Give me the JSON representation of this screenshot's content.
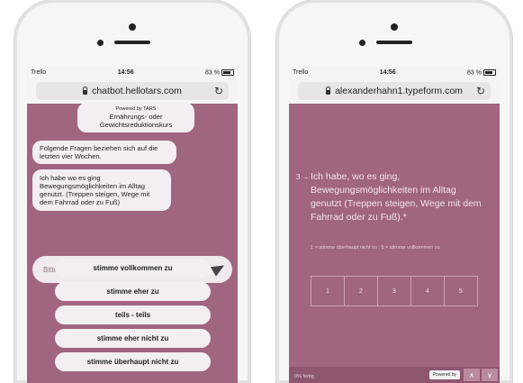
{
  "left_phone": {
    "status": {
      "carrier": "Trello",
      "time": "14:56",
      "battery": "83 %"
    },
    "url": "chatbot.hellotars.com",
    "chat": {
      "powered_by": "Powered by TARS",
      "bubble_top": "Ernährungs- oder Gewichtsreduktionskurs",
      "bubble_2": "Folgende Fragen beziehen sich auf die letzten vier Wochen.",
      "bubble_3": "Ich habe wo es ging Bewegungsmöglichkeiten im Alltag genutzt. (Treppen steigen, Wege mit dem Fahrrad oder zu Fuß)",
      "input_placeholder": "Bitte auswählen:",
      "choices": [
        "stimme vollkommen zu",
        "stimme eher zu",
        "teils - teils",
        "stimme eher nicht zu",
        "stimme überhaupt nicht zu"
      ]
    }
  },
  "right_phone": {
    "status": {
      "carrier": "Trello",
      "time": "14:56",
      "battery": "83 %"
    },
    "url": "alexanderhahn1.typeform.com",
    "question_number": "3 →",
    "question": "Ich habe, wo es ging, Bewegungsmöglichkeiten im Alltag genutzt (Treppen steigen, Wege mit dem Fahrrad oder zu Fuß).*",
    "hint": "1 = stimme überhaupt nicht zu ; 5 = stimme vollkommen zu",
    "scale": [
      "1",
      "2",
      "3",
      "4",
      "5"
    ],
    "footer": {
      "progress": "0% fertig",
      "powered": "Powered by",
      "prev": "∧",
      "next": "∨"
    }
  }
}
